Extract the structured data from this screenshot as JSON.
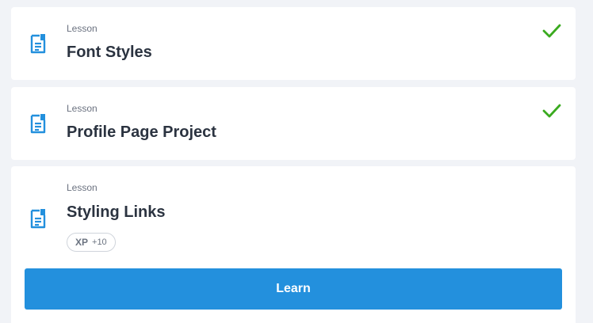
{
  "lessons": [
    {
      "kind": "Lesson",
      "title": "Font Styles",
      "completed": true,
      "icon": "document-icon",
      "status_icon": "checkmark-icon"
    },
    {
      "kind": "Lesson",
      "title": "Profile Page Project",
      "completed": true,
      "icon": "document-icon",
      "status_icon": "checkmark-icon"
    },
    {
      "kind": "Lesson",
      "title": "Styling Links",
      "completed": false,
      "icon": "document-icon",
      "xp": {
        "label": "XP",
        "value": "+10"
      },
      "action_label": "Learn"
    }
  ],
  "colors": {
    "background": "#f1f3f7",
    "card": "#ffffff",
    "icon_blue": "#2390dd",
    "check_green": "#3aaa1f",
    "button_blue": "#2390dd",
    "title_text": "#2b3340",
    "muted_text": "#6b7280"
  }
}
